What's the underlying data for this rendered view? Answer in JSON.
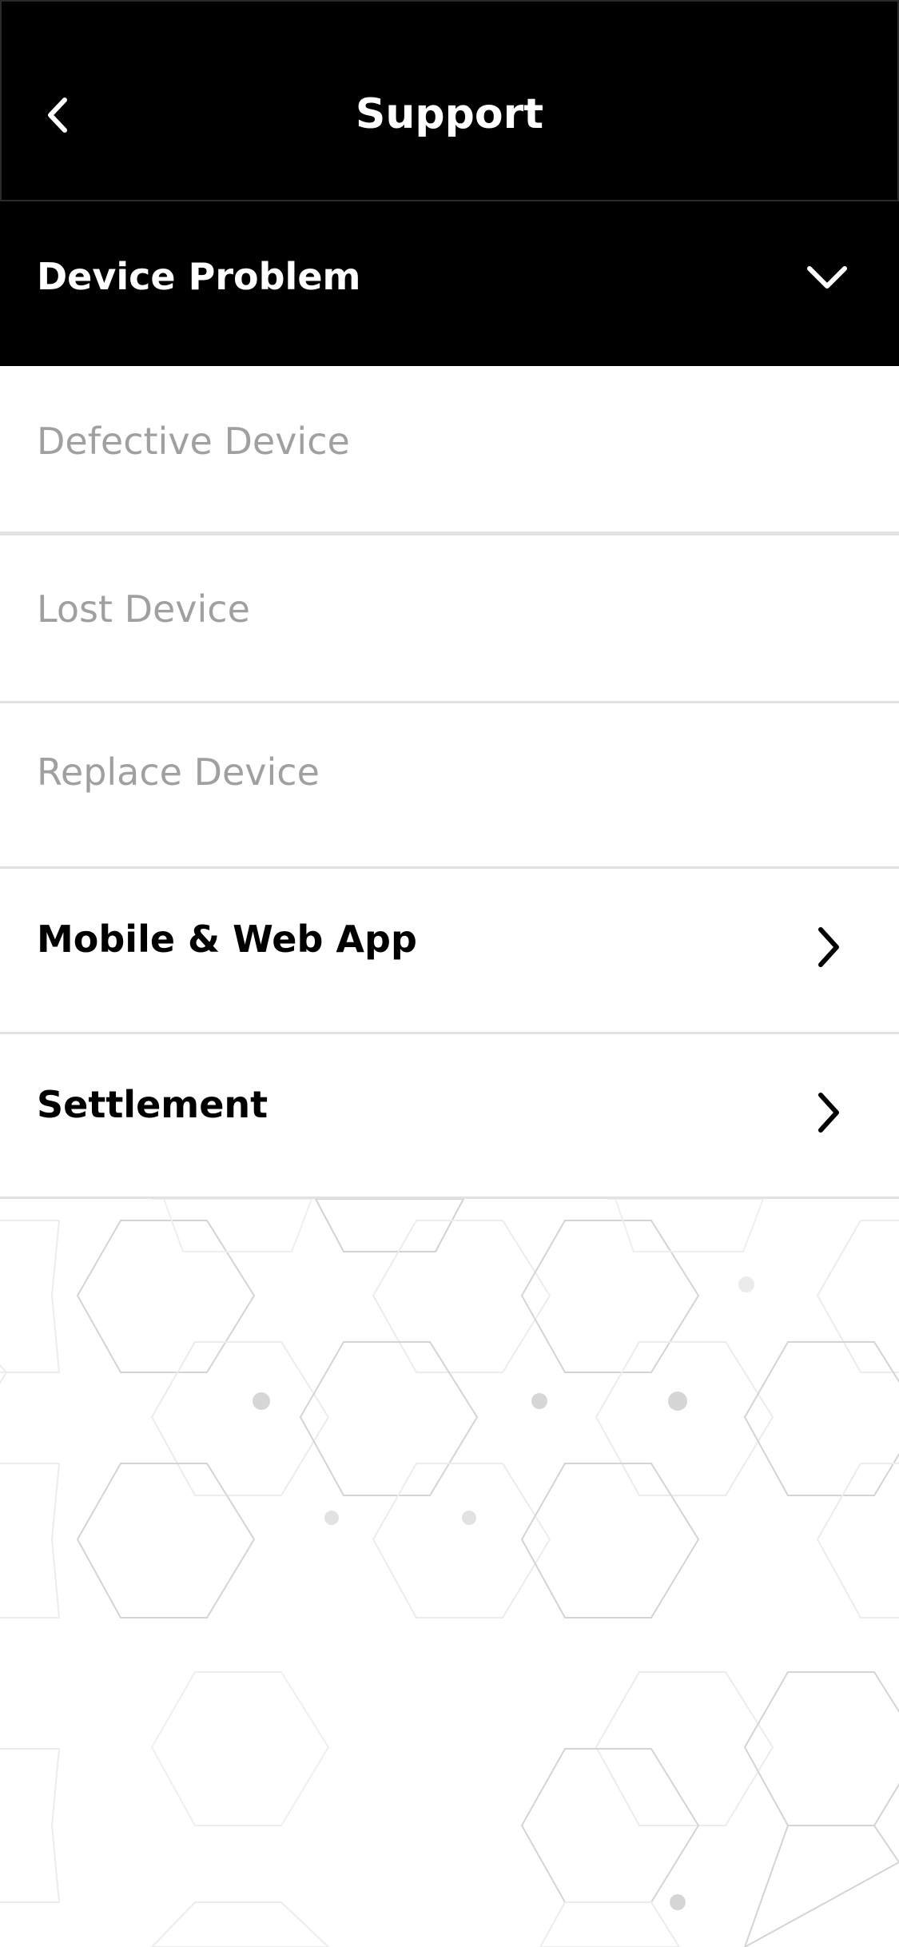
{
  "header": {
    "title": "Support",
    "back_icon": "chevron-left-icon"
  },
  "category": {
    "label": "Device Problem",
    "expanded_icon": "chevron-down-icon",
    "sub_items": [
      {
        "label": "Defective Device"
      },
      {
        "label": "Lost Device"
      },
      {
        "label": "Replace Device"
      }
    ]
  },
  "items": [
    {
      "label": "Mobile & Web App",
      "icon": "chevron-right-icon"
    },
    {
      "label": "Settlement",
      "icon": "chevron-right-icon"
    }
  ],
  "colors": {
    "header_bg": "#000000",
    "header_text": "#ffffff",
    "sub_item_text": "#a0a0a0",
    "item_text": "#000000",
    "divider": "#e2e2e2"
  }
}
